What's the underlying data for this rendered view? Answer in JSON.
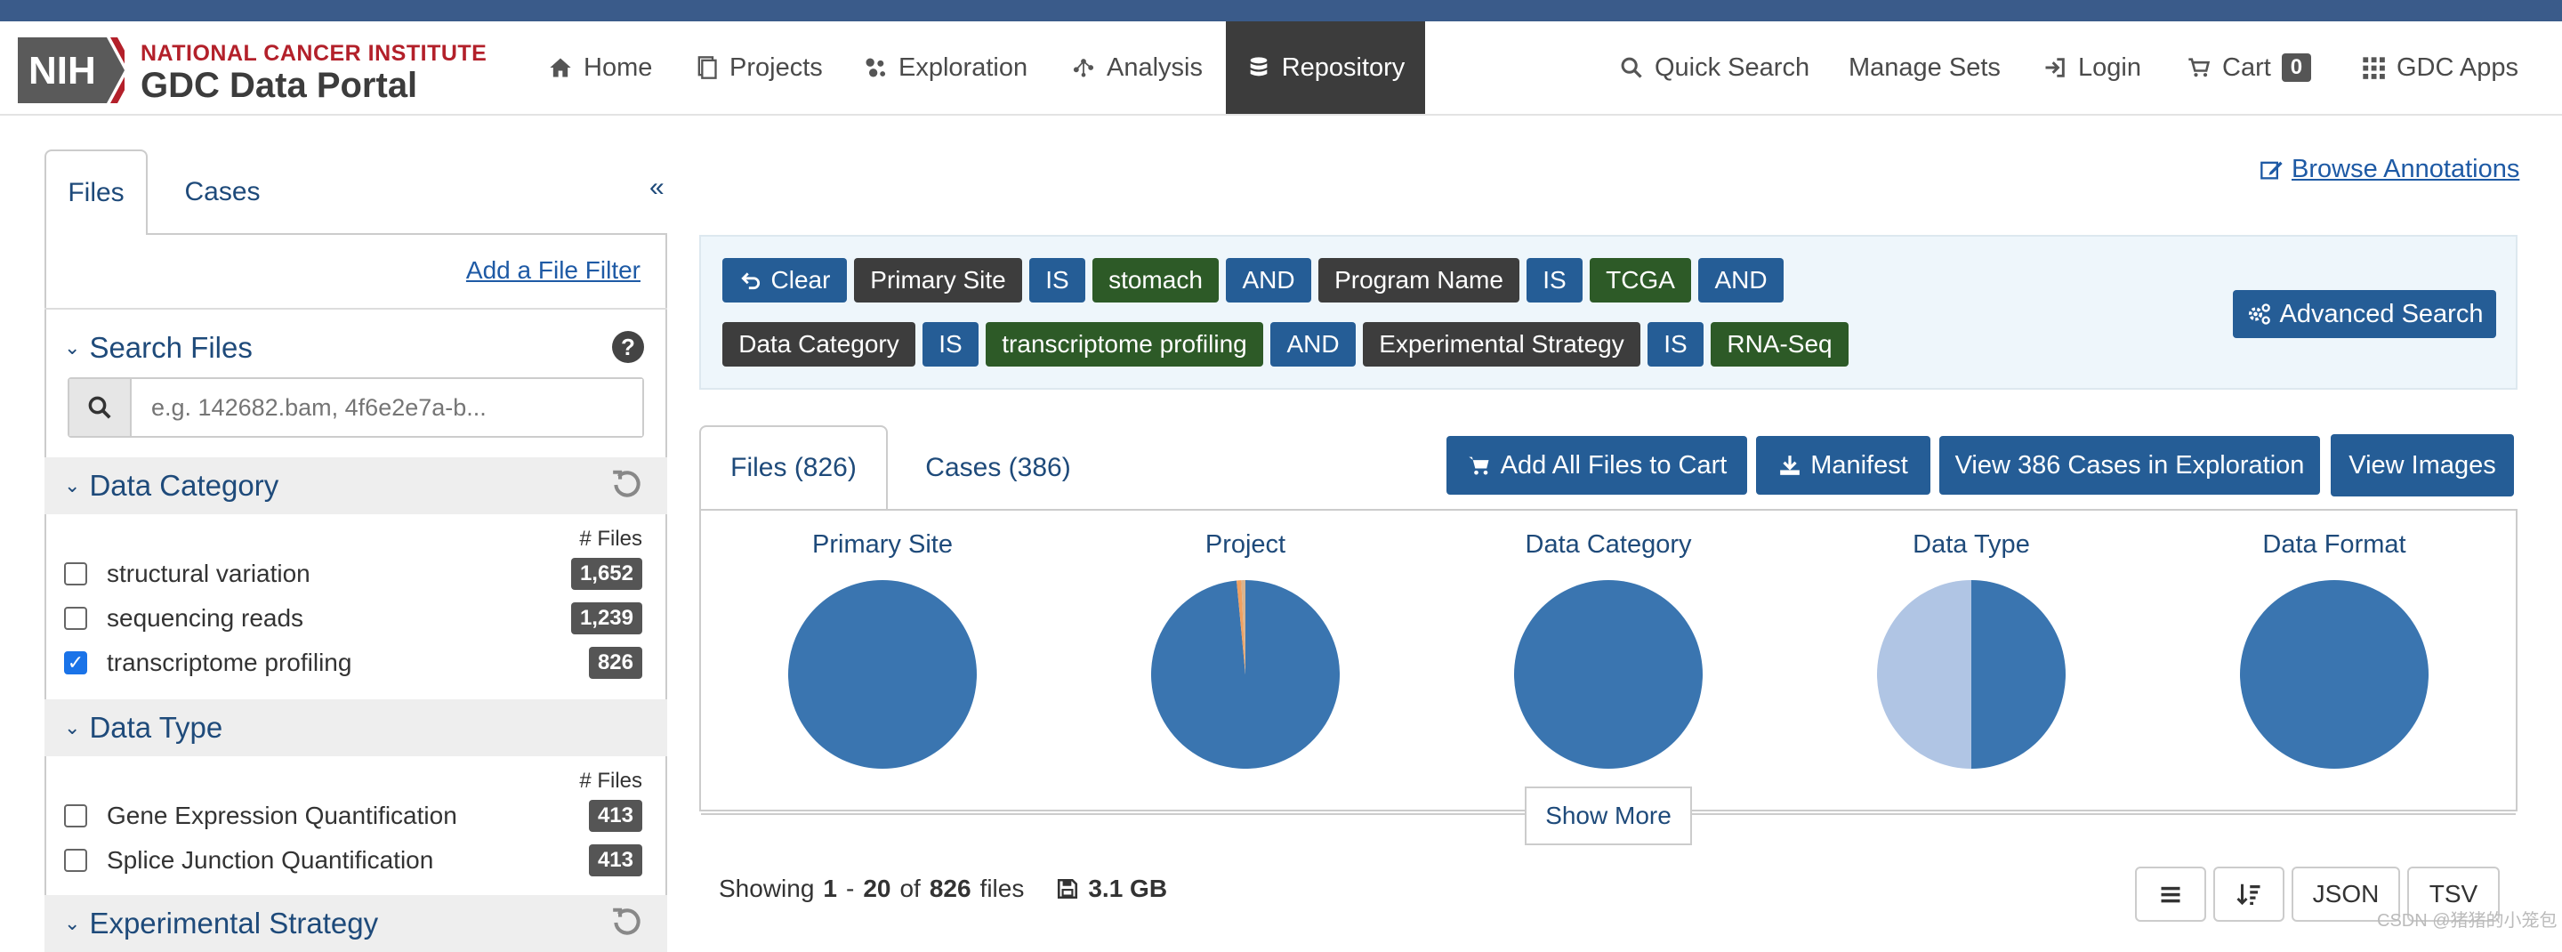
{
  "header": {
    "logo_nih": "NIH",
    "logo_line1": "NATIONAL CANCER INSTITUTE",
    "logo_line2": "GDC Data Portal",
    "nav": [
      {
        "label": "Home",
        "icon": "home-icon"
      },
      {
        "label": "Projects",
        "icon": "projects-icon"
      },
      {
        "label": "Exploration",
        "icon": "exploration-icon"
      },
      {
        "label": "Analysis",
        "icon": "analysis-icon"
      },
      {
        "label": "Repository",
        "icon": "database-icon",
        "active": true
      }
    ],
    "right": {
      "quick_search": "Quick Search",
      "manage_sets": "Manage Sets",
      "login": "Login",
      "cart": "Cart",
      "cart_count": "0",
      "gdc_apps": "GDC Apps"
    }
  },
  "sidebar": {
    "tabs": [
      "Files",
      "Cases"
    ],
    "collapse": "«",
    "add_filter": "Add a File Filter",
    "search": {
      "title": "Search Files",
      "placeholder": "e.g. 142682.bam, 4f6e2e7a-b..."
    },
    "data_category": {
      "title": "Data Category",
      "files_header": "# Files",
      "items": [
        {
          "label": "structural variation",
          "count": "1,652",
          "checked": false
        },
        {
          "label": "sequencing reads",
          "count": "1,239",
          "checked": false
        },
        {
          "label": "transcriptome profiling",
          "count": "826",
          "checked": true
        }
      ]
    },
    "data_type": {
      "title": "Data Type",
      "files_header": "# Files",
      "items": [
        {
          "label": "Gene Expression Quantification",
          "count": "413",
          "checked": false
        },
        {
          "label": "Splice Junction Quantification",
          "count": "413",
          "checked": false
        }
      ]
    },
    "experimental_strategy": {
      "title": "Experimental Strategy"
    }
  },
  "main": {
    "browse_annotations": "Browse Annotations",
    "query": {
      "clear": "Clear",
      "row1": [
        {
          "text": "Primary Site",
          "style": "dark"
        },
        {
          "text": "IS",
          "style": "blue"
        },
        {
          "text": "stomach",
          "style": "green"
        },
        {
          "text": "AND",
          "style": "blue"
        },
        {
          "text": "Program Name",
          "style": "dark"
        },
        {
          "text": "IS",
          "style": "blue"
        },
        {
          "text": "TCGA",
          "style": "green"
        },
        {
          "text": "AND",
          "style": "blue"
        }
      ],
      "row2": [
        {
          "text": "Data Category",
          "style": "dark"
        },
        {
          "text": "IS",
          "style": "blue"
        },
        {
          "text": "transcriptome profiling",
          "style": "green"
        },
        {
          "text": "AND",
          "style": "blue"
        },
        {
          "text": "Experimental Strategy",
          "style": "dark"
        },
        {
          "text": "IS",
          "style": "blue"
        },
        {
          "text": "RNA-Seq",
          "style": "green"
        }
      ],
      "advanced_search": "Advanced Search"
    },
    "tabs": [
      "Files (826)",
      "Cases (386)"
    ],
    "actions": {
      "add_all": "Add All Files to Cart",
      "manifest": "Manifest",
      "view_cases": "View 386 Cases in Exploration",
      "view_images": "View Images"
    },
    "charts": [
      {
        "title": "Primary Site",
        "slices": [
          {
            "value": 1.0,
            "color": "#3a75b0"
          }
        ]
      },
      {
        "title": "Project",
        "slices": [
          {
            "value": 0.985,
            "color": "#3a75b0"
          },
          {
            "value": 0.008,
            "color": "#f0a060"
          },
          {
            "value": 0.007,
            "color": "#d9b48f"
          }
        ]
      },
      {
        "title": "Data Category",
        "slices": [
          {
            "value": 1.0,
            "color": "#3a75b0"
          }
        ]
      },
      {
        "title": "Data Type",
        "slices": [
          {
            "value": 0.5,
            "color": "#3a75b0"
          },
          {
            "value": 0.5,
            "color": "#b0c5e4"
          }
        ]
      },
      {
        "title": "Data Format",
        "slices": [
          {
            "value": 1.0,
            "color": "#3a75b0"
          }
        ]
      }
    ],
    "show_more": "Show More",
    "showing": {
      "prefix": "Showing",
      "from": "1",
      "to": "20",
      "of_word": "of",
      "total": "826",
      "suffix": "files",
      "size": "3.1 GB"
    },
    "tools": {
      "json": "JSON",
      "tsv": "TSV"
    }
  },
  "watermark": "CSDN @猪猪的小笼包"
}
